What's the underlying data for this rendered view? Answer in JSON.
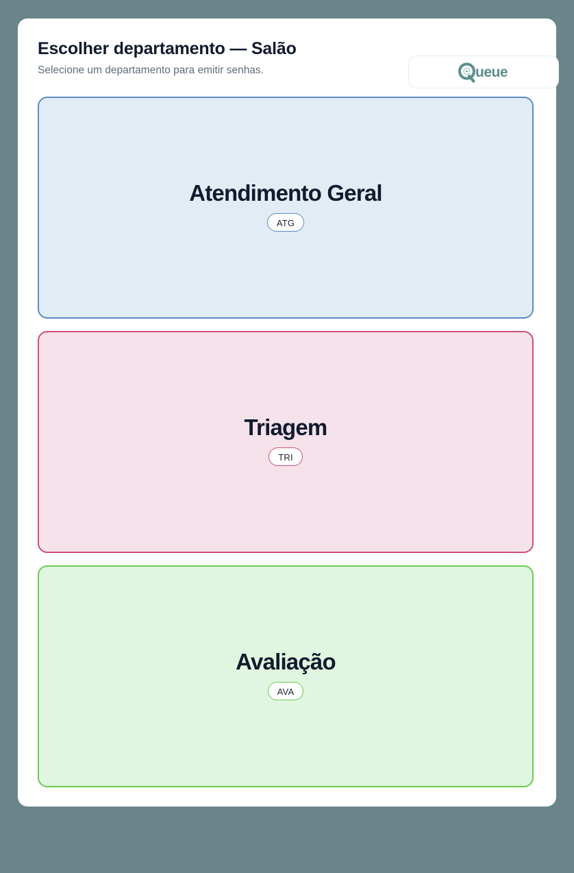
{
  "header": {
    "title": "Escolher departamento — Salão",
    "subtitle": "Selecione um departamento para emitir senhas."
  },
  "logo": {
    "text": "ueue",
    "icon": "q-logo-icon",
    "color": "#5b8e8c"
  },
  "departments": [
    {
      "name": "Atendimento Geral",
      "code": "ATG",
      "border_color": "#5b8cc4",
      "bg_color": "#e2ecf5"
    },
    {
      "name": "Triagem",
      "code": "TRI",
      "border_color": "#cf4f76",
      "bg_color": "#f6e2eb"
    },
    {
      "name": "Avaliação",
      "code": "AVA",
      "border_color": "#6ecb4c",
      "bg_color": "#e0f6e0"
    }
  ],
  "colors": {
    "page_background": "#698589",
    "card_background": "#ffffff",
    "title_text": "#111a2e",
    "subtitle_text": "#5f6d7e"
  }
}
